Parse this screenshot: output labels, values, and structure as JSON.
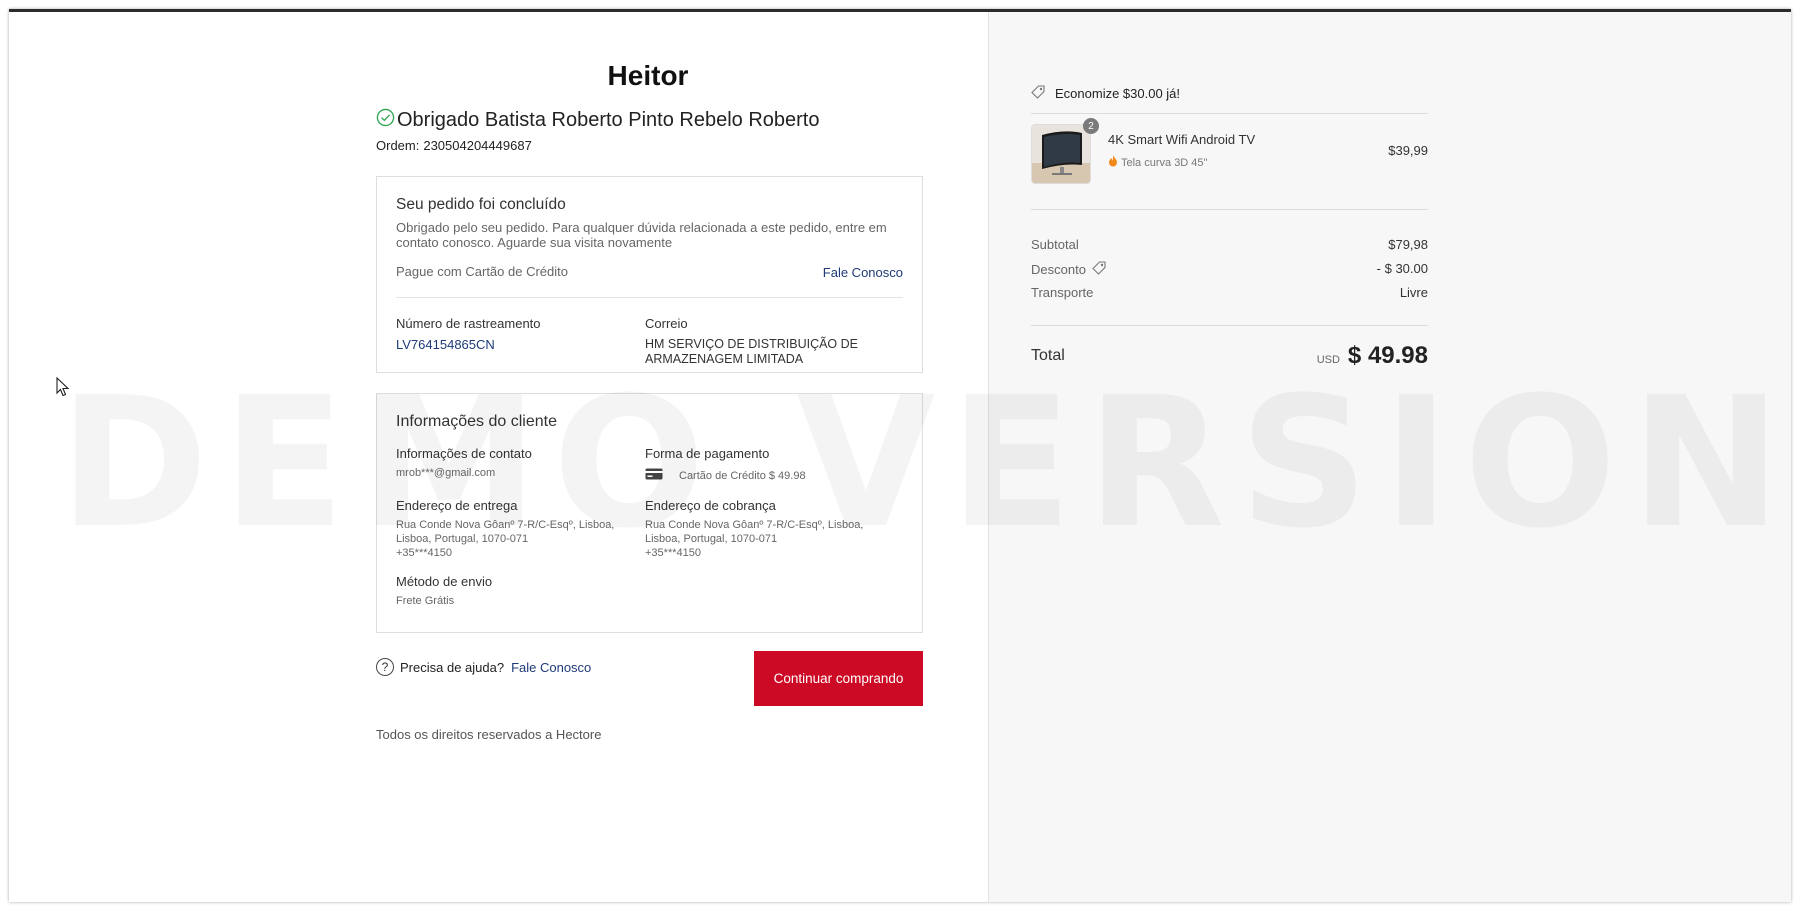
{
  "store": {
    "name": "Heitor"
  },
  "confirmation": {
    "thanks": "Obrigado Batista Roberto Pinto Rebelo Roberto",
    "order_label": "Ordem:",
    "order_number": "230504204449687"
  },
  "status_card": {
    "title": "Seu pedido foi concluído",
    "message": "Obrigado pelo seu pedido. Para qualquer dúvida relacionada a este pedido, entre em contato conosco. Aguarde sua visita novamente",
    "payment_note": "Pague com Cartão de Crédito",
    "contact_link": "Fale Conosco",
    "tracking_label": "Número de rastreamento",
    "tracking_number": "LV764154865CN",
    "carrier_label": "Correio",
    "carrier_name": "HM SERVIÇO DE DISTRIBUIÇÃO DE ARMAZENAGEM LIMITADA"
  },
  "customer_card": {
    "title": "Informações do cliente",
    "contact_label": "Informações de contato",
    "contact_value": "mrob***@gmail.com",
    "payment_label": "Forma de pagamento",
    "payment_value": "Cartão de Crédito $ 49.98",
    "shipping_address_label": "Endereço de entrega",
    "shipping_address_line1": "Rua Conde Nova Gôanº 7-R/C-Esqº, Lisboa,",
    "shipping_address_line2": "Lisboa, Portugal, 1070-071",
    "shipping_address_phone": "+35***4150",
    "billing_address_label": "Endereço de cobrança",
    "billing_address_line1": "Rua Conde Nova Gôanº 7-R/C-Esqº, Lisboa,",
    "billing_address_line2": "Lisboa, Portugal, 1070-071",
    "billing_address_phone": "+35***4150",
    "shipping_method_label": "Método de envio",
    "shipping_method_value": "Frete Grátis"
  },
  "help": {
    "text": "Precisa de ajuda?",
    "link": "Fale Conosco"
  },
  "continue_button": "Continuar comprando",
  "footer": "Todos os direitos reservados a Hectore",
  "summary": {
    "promo": "Economize $30.00 já!",
    "product": {
      "name": "4K Smart Wifi Android TV",
      "variant": "Tela curva 3D 45\"",
      "price": "$39,99",
      "quantity": "2"
    },
    "subtotal_label": "Subtotal",
    "subtotal_value": "$79,98",
    "discount_label": "Desconto",
    "discount_value": "- $ 30.00",
    "shipping_label": "Transporte",
    "shipping_value": "Livre",
    "total_label": "Total",
    "currency": "USD",
    "total_value": "$ 49.98"
  },
  "watermark": "DEMO VERSION",
  "colors": {
    "accent": "#cc0a26",
    "link": "#1e3a78",
    "success": "#2ea44f"
  },
  "icons": [
    "check-circle-icon",
    "credit-card-icon",
    "help-circle-icon",
    "tag-icon",
    "flame-icon",
    "cursor-icon"
  ]
}
